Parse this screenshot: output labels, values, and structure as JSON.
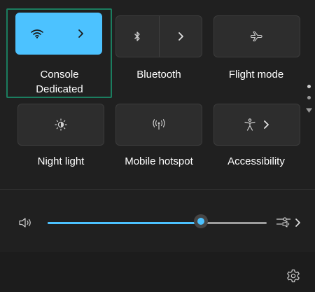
{
  "quick_settings": {
    "tiles": [
      {
        "label_line1": "Console",
        "label_line2": "Dedicated",
        "icon": "wifi-icon",
        "state": "on",
        "has_expand": true
      },
      {
        "label_line1": "Bluetooth",
        "icon": "bluetooth-icon",
        "state": "off",
        "has_expand": true
      },
      {
        "label_line1": "Flight mode",
        "icon": "airplane-icon",
        "state": "off",
        "has_expand": false
      },
      {
        "label_line1": "Night light",
        "icon": "night-light-icon",
        "state": "off",
        "has_expand": false
      },
      {
        "label_line1": "Mobile hotspot",
        "icon": "hotspot-icon",
        "state": "off",
        "has_expand": false
      },
      {
        "label_line1": "Accessibility",
        "icon": "accessibility-icon",
        "state": "off",
        "has_expand": true
      }
    ],
    "page_indicator": {
      "pages": 2,
      "current": 1
    },
    "volume": {
      "level": 0.7,
      "icon": "speaker-icon",
      "mixer_icon": "sound-output-icon"
    },
    "footer": {
      "settings_icon": "gear-icon"
    },
    "colors": {
      "accent": "#4cc2ff",
      "panel": "#202020",
      "tile": "#2d2d2d",
      "focus": "#1b7d5f"
    }
  }
}
